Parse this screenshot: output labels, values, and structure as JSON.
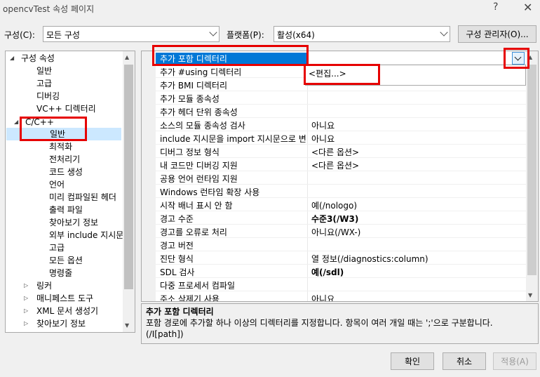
{
  "window": {
    "title": "opencvTest 속성 페이지",
    "help": "?",
    "close": "✕"
  },
  "top": {
    "config_label": "구성(C):",
    "config_value": "모든 구성",
    "platform_label": "플랫폼(P):",
    "platform_value": "활성(x64)",
    "manager_button": "구성 관리자(O)..."
  },
  "tree": {
    "items": [
      {
        "label": "구성 속성",
        "expander": "◢"
      },
      {
        "label": "일반"
      },
      {
        "label": "고급"
      },
      {
        "label": "디버깅"
      },
      {
        "label": "VC++ 디렉터리"
      },
      {
        "label": "C/C++",
        "expander": "◢"
      },
      {
        "label": "일반"
      },
      {
        "label": "최적화"
      },
      {
        "label": "전처리기"
      },
      {
        "label": "코드 생성"
      },
      {
        "label": "언어"
      },
      {
        "label": "미리 컴파일된 헤더"
      },
      {
        "label": "출력 파일"
      },
      {
        "label": "찾아보기 정보"
      },
      {
        "label": "외부 include 지시문"
      },
      {
        "label": "고급"
      },
      {
        "label": "모든 옵션"
      },
      {
        "label": "명령줄"
      },
      {
        "label": "링커",
        "expander": "▷"
      },
      {
        "label": "매니페스트 도구",
        "expander": "▷"
      },
      {
        "label": "XML 문서 생성기",
        "expander": "▷"
      },
      {
        "label": "찾아보기 정보",
        "expander": "▷"
      }
    ]
  },
  "grid": {
    "rows": [
      {
        "name": "추가 포함 디렉터리",
        "value": ""
      },
      {
        "name": "추가 #using 디렉터리",
        "value": ""
      },
      {
        "name": "추가 BMI 디렉터리",
        "value": ""
      },
      {
        "name": "추가 모듈 종속성",
        "value": ""
      },
      {
        "name": "추가 헤더 단위 종속성",
        "value": ""
      },
      {
        "name": "소스의 모듈 종속성 검사",
        "value": "아니요"
      },
      {
        "name": "include 지시문을 import 지시문으로 변",
        "value": "아니요"
      },
      {
        "name": "디버그 정보 형식",
        "value": "<다른 옵션>"
      },
      {
        "name": "내 코드만 디버깅 지원",
        "value": "<다른 옵션>"
      },
      {
        "name": "공용 언어 런타임 지원",
        "value": ""
      },
      {
        "name": "Windows 런타임 확장 사용",
        "value": ""
      },
      {
        "name": "시작 배너 표시 안 함",
        "value": "예(/nologo)"
      },
      {
        "name": "경고 수준",
        "value": "수준3(/W3)"
      },
      {
        "name": "경고를 오류로 처리",
        "value": "아니요(/WX-)"
      },
      {
        "name": "경고 버전",
        "value": ""
      },
      {
        "name": "진단 형식",
        "value": "열 정보(/diagnostics:column)"
      },
      {
        "name": "SDL 검사",
        "value": "예(/sdl)"
      },
      {
        "name": "다중 프로세서 컴파일",
        "value": ""
      },
      {
        "name": "주소 삭제기 사용",
        "value": "아니요"
      }
    ],
    "dropdown_item": "<편집...>"
  },
  "description": {
    "title": "추가 포함 디렉터리",
    "text": "포함 경로에 추가할 하나 이상의 디렉터리를 지정합니다. 항목이 여러 개일 때는 ';'으로 구분합니다.",
    "switch": "(/I[path])"
  },
  "buttons": {
    "ok": "확인",
    "cancel": "취소",
    "apply": "적용(A)"
  },
  "colors": {
    "selection": "#0078d7",
    "tree_selection": "#cce8ff",
    "highlight_box": "#e60000"
  }
}
